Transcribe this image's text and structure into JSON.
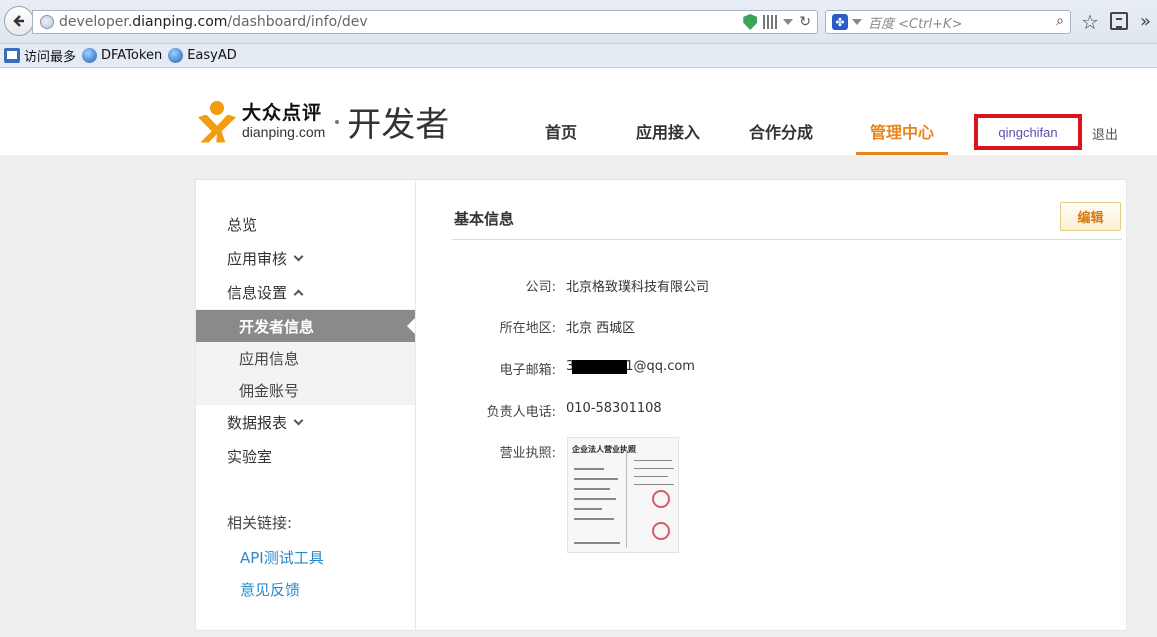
{
  "browser": {
    "url_prefix": "developer.",
    "url_host": "dianping.com",
    "url_path": "/dashboard/info/dev",
    "search_placeholder": "百度 <Ctrl+K>"
  },
  "bookmarks": [
    "访问最多",
    "DFAToken",
    "EasyAD"
  ],
  "header": {
    "logo_cn": "大众点评",
    "logo_en": "dianping.com",
    "logo_suffix": "开发者",
    "nav": [
      "首页",
      "应用接入",
      "合作分成",
      "管理中心"
    ],
    "username": "qingchifan",
    "logout": "退出"
  },
  "sidebar": {
    "overview": "总览",
    "app_review": "应用审核",
    "info_settings": "信息设置",
    "sub_items": [
      "开发者信息",
      "应用信息",
      "佣金账号"
    ],
    "reports": "数据报表",
    "lab": "实验室",
    "related_title": "相关链接:",
    "related_links": [
      "API测试工具",
      "意见反馈"
    ]
  },
  "content": {
    "section_title": "基本信息",
    "edit_label": "编辑",
    "rows": [
      {
        "label": "公司:",
        "value": "北京格致璞科技有限公司"
      },
      {
        "label": "所在地区:",
        "value": "北京 西城区"
      },
      {
        "label": "电子邮箱:",
        "value_start": "3",
        "value_end": "1@qq.com"
      },
      {
        "label": "负责人电话:",
        "value": "010-58301108"
      },
      {
        "label": "营业执照:"
      }
    ],
    "license_title": "企业法人营业执照"
  }
}
